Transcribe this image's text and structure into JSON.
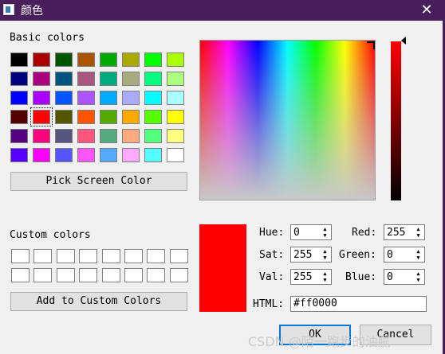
{
  "window": {
    "title": "颜色",
    "close_glyph": "✕"
  },
  "labels": {
    "basic_colors": "Basic colors",
    "custom_colors": "Custom colors",
    "hue": "Hue:",
    "sat": "Sat:",
    "val": "Val:",
    "red": "Red:",
    "green": "Green:",
    "blue": "Blue:",
    "html": "HTML:"
  },
  "buttons": {
    "pick_screen": "Pick Screen Color",
    "add_custom": "Add to Custom Colors",
    "ok": "OK",
    "cancel": "Cancel"
  },
  "fields": {
    "hue": "0",
    "sat": "255",
    "val": "255",
    "red": "255",
    "green": "0",
    "blue": "0",
    "html": "#ff0000"
  },
  "basic_colors": [
    [
      "#000000",
      "#aa0000",
      "#005500",
      "#aa5500",
      "#00aa00",
      "#aaaa00",
      "#00ff00",
      "#aaff00"
    ],
    [
      "#00007f",
      "#aa007f",
      "#00557f",
      "#aa557f",
      "#00aa7f",
      "#aaaa7f",
      "#00ff7f",
      "#aaff7f"
    ],
    [
      "#0000ff",
      "#aa00ff",
      "#0055ff",
      "#aa55ff",
      "#00aaff",
      "#aaaaff",
      "#00ffff",
      "#aaffff"
    ],
    [
      "#550000",
      "#ff0000",
      "#555500",
      "#ff5500",
      "#55aa00",
      "#ffaa00",
      "#55ff00",
      "#ffff00"
    ],
    [
      "#55007f",
      "#ff007f",
      "#55557f",
      "#ff557f",
      "#55aa7f",
      "#ffaa7f",
      "#55ff7f",
      "#ffff7f"
    ],
    [
      "#5500ff",
      "#ff00ff",
      "#5555ff",
      "#ff55ff",
      "#55aaff",
      "#ffaaff",
      "#55ffff",
      "#ffffff"
    ]
  ],
  "selected_basic": [
    3,
    1
  ],
  "current_color": "#ff0000",
  "watermark": "CSDN @陌一跑步的油腻"
}
